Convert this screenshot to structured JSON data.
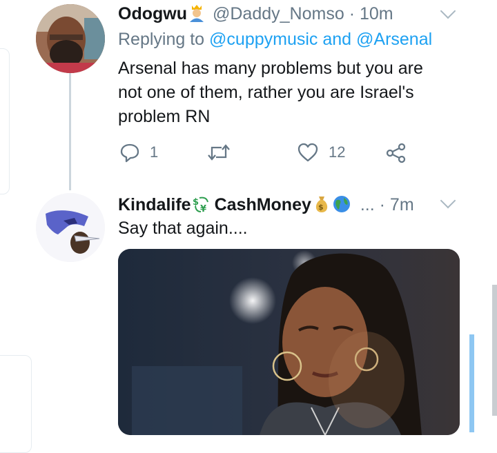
{
  "tweet1": {
    "display_name": "Odogwu",
    "handle": "@Daddy_Nomso",
    "time": "· 10m",
    "reply_prefix": "Replying to ",
    "reply_to_1": "@cuppymusic",
    "reply_and": " and ",
    "reply_to_2": "@Arsenal",
    "text_line1": "Arsenal has many problems but you are",
    "text_line2": "not one of them, rather you are Israel's",
    "text_line3": "problem RN",
    "reply_count": "1",
    "like_count": "12",
    "icons": [
      "crown-person-emoji",
      "reply-icon",
      "retweet-icon",
      "like-icon",
      "share-icon",
      "chevron-down-icon"
    ]
  },
  "tweet2": {
    "display_name": "Kindalife",
    "display_name_2": "CashMoney",
    "ellipsis": "...",
    "time": "· 7m",
    "text": "Say that again....",
    "icons": [
      "currency-exchange-emoji",
      "money-bag-emoji",
      "globe-emoji",
      "chevron-down-icon"
    ]
  },
  "colors": {
    "accent": "#1da1f2",
    "muted": "#657786",
    "text": "#14171a",
    "thread_line": "#ccd6dd"
  }
}
